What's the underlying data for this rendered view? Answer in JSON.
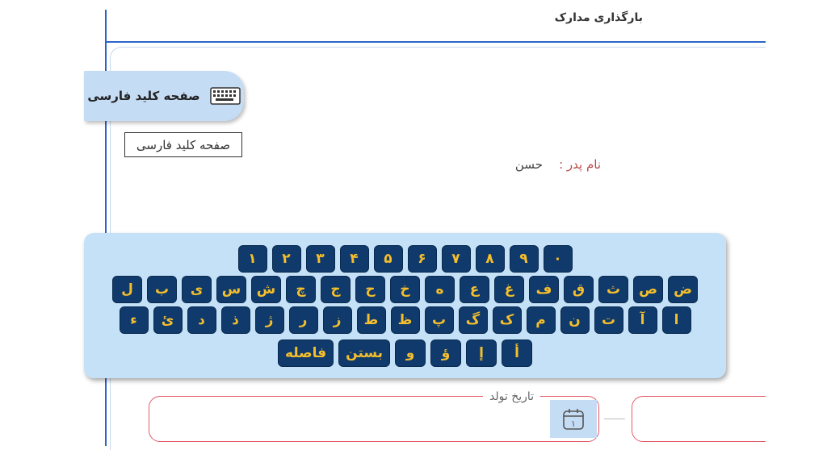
{
  "header": {
    "title": "بارگذاری مدارک"
  },
  "keyboard_toggle": {
    "label": "صفحه کلید فارسی",
    "icon": "keyboard-icon"
  },
  "tooltip": {
    "text": "صفحه کلید فارسی"
  },
  "father": {
    "label": "نام پدر :",
    "value": "حسن"
  },
  "keyboard": {
    "row1": [
      "۱",
      "۲",
      "۳",
      "۴",
      "۵",
      "۶",
      "۷",
      "۸",
      "۹",
      "۰"
    ],
    "row2": [
      "ض",
      "ص",
      "ث",
      "ق",
      "ف",
      "غ",
      "ع",
      "ه",
      "خ",
      "ح",
      "ج",
      "چ",
      "ش",
      "س",
      "ی",
      "ب",
      "ل"
    ],
    "row3": [
      "ا",
      "آ",
      "ت",
      "ن",
      "م",
      "ک",
      "گ",
      "پ",
      "ظ",
      "ط",
      "ز",
      "ر",
      "ژ",
      "ذ",
      "د",
      "ئ",
      "ء"
    ],
    "row4": [
      "أ",
      "إ",
      "ؤ",
      "و",
      "بستن",
      "فاصله"
    ]
  },
  "birth_date": {
    "label": "تاریخ تولد",
    "value": "",
    "icon": "calendar-icon",
    "icon_digit": "۱"
  },
  "colors": {
    "accent": "#2b64c9",
    "key_bg": "#0f3a6b",
    "key_text": "#f4be2c",
    "panel_bg": "#c5e1f7",
    "field_border": "#e45b6a"
  }
}
